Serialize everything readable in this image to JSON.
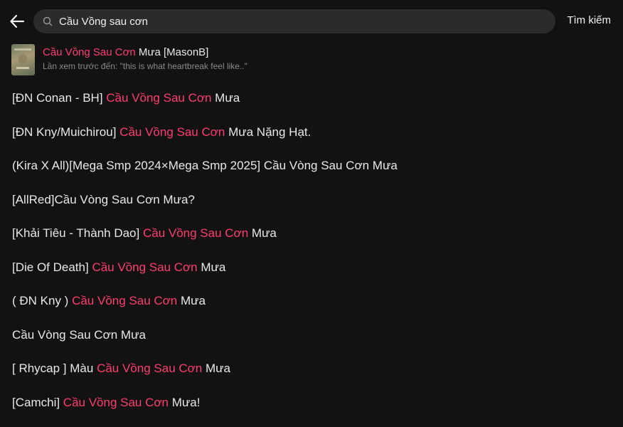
{
  "header": {
    "search_value": "Cầu Vồng sau cơn",
    "search_button": "Tìm kiếm"
  },
  "top_result": {
    "title_highlight": "Cầu Vồng Sau Cơn",
    "title_rest": " Mưa [MasonB]",
    "subtitle": "Lần xem trước đến:  \"this is what heartbreak feel like..\""
  },
  "suggestions": [
    {
      "pre": "[ĐN Conan - BH] ",
      "hl": "Cầu Vồng Sau Cơn",
      "post": " Mưa"
    },
    {
      "pre": "[ĐN Kny/Muichirou] ",
      "hl": "Cầu Vồng Sau Cơn",
      "post": " Mưa Nặng Hạt."
    },
    {
      "pre": "(Kira X All)[Mega Smp 2024×Mega Smp 2025] Cầu Vòng Sau Cơn Mưa",
      "hl": "",
      "post": ""
    },
    {
      "pre": "[AllRed]Cầu Vòng Sau Cơn Mưa?",
      "hl": "",
      "post": ""
    },
    {
      "pre": "[Khải Tiêu - Thành Dao] ",
      "hl": "Cầu Vồng Sau Cơn",
      "post": " Mưa"
    },
    {
      "pre": "[Die Of Death] ",
      "hl": "Cầu Vồng Sau Cơn",
      "post": " Mưa"
    },
    {
      "pre": "( ĐN Kny ) ",
      "hl": "Cầu Vồng Sau Cơn",
      "post": " Mưa"
    },
    {
      "pre": "Cầu Vòng Sau Cơn Mưa",
      "hl": "",
      "post": ""
    },
    {
      "pre": "[ Rhycap ] Màu ",
      "hl": "Cầu Vồng Sau Cơn",
      "post": " Mưa"
    },
    {
      "pre": "[Camchi] ",
      "hl": "Cầu Vồng Sau Cơn",
      "post": " Mưa!"
    }
  ],
  "colors": {
    "background": "#121212",
    "highlight": "#ff3d6e",
    "search_bg": "#2b2b2b"
  },
  "icons": {
    "back": "back-arrow-icon",
    "search": "search-icon"
  }
}
